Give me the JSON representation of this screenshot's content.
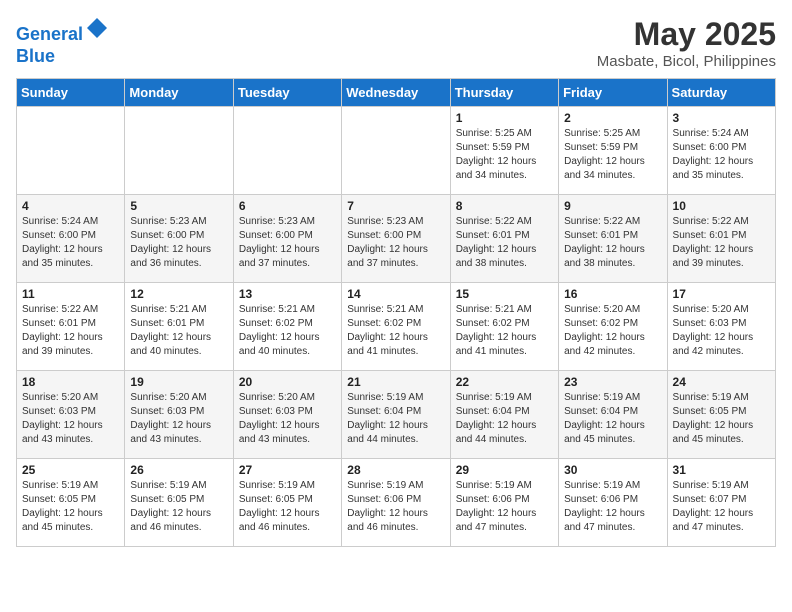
{
  "header": {
    "logo_line1": "General",
    "logo_line2": "Blue",
    "month_year": "May 2025",
    "location": "Masbate, Bicol, Philippines"
  },
  "days_of_week": [
    "Sunday",
    "Monday",
    "Tuesday",
    "Wednesday",
    "Thursday",
    "Friday",
    "Saturday"
  ],
  "weeks": [
    [
      {
        "num": "",
        "detail": ""
      },
      {
        "num": "",
        "detail": ""
      },
      {
        "num": "",
        "detail": ""
      },
      {
        "num": "",
        "detail": ""
      },
      {
        "num": "1",
        "detail": "Sunrise: 5:25 AM\nSunset: 5:59 PM\nDaylight: 12 hours\nand 34 minutes."
      },
      {
        "num": "2",
        "detail": "Sunrise: 5:25 AM\nSunset: 5:59 PM\nDaylight: 12 hours\nand 34 minutes."
      },
      {
        "num": "3",
        "detail": "Sunrise: 5:24 AM\nSunset: 6:00 PM\nDaylight: 12 hours\nand 35 minutes."
      }
    ],
    [
      {
        "num": "4",
        "detail": "Sunrise: 5:24 AM\nSunset: 6:00 PM\nDaylight: 12 hours\nand 35 minutes."
      },
      {
        "num": "5",
        "detail": "Sunrise: 5:23 AM\nSunset: 6:00 PM\nDaylight: 12 hours\nand 36 minutes."
      },
      {
        "num": "6",
        "detail": "Sunrise: 5:23 AM\nSunset: 6:00 PM\nDaylight: 12 hours\nand 37 minutes."
      },
      {
        "num": "7",
        "detail": "Sunrise: 5:23 AM\nSunset: 6:00 PM\nDaylight: 12 hours\nand 37 minutes."
      },
      {
        "num": "8",
        "detail": "Sunrise: 5:22 AM\nSunset: 6:01 PM\nDaylight: 12 hours\nand 38 minutes."
      },
      {
        "num": "9",
        "detail": "Sunrise: 5:22 AM\nSunset: 6:01 PM\nDaylight: 12 hours\nand 38 minutes."
      },
      {
        "num": "10",
        "detail": "Sunrise: 5:22 AM\nSunset: 6:01 PM\nDaylight: 12 hours\nand 39 minutes."
      }
    ],
    [
      {
        "num": "11",
        "detail": "Sunrise: 5:22 AM\nSunset: 6:01 PM\nDaylight: 12 hours\nand 39 minutes."
      },
      {
        "num": "12",
        "detail": "Sunrise: 5:21 AM\nSunset: 6:01 PM\nDaylight: 12 hours\nand 40 minutes."
      },
      {
        "num": "13",
        "detail": "Sunrise: 5:21 AM\nSunset: 6:02 PM\nDaylight: 12 hours\nand 40 minutes."
      },
      {
        "num": "14",
        "detail": "Sunrise: 5:21 AM\nSunset: 6:02 PM\nDaylight: 12 hours\nand 41 minutes."
      },
      {
        "num": "15",
        "detail": "Sunrise: 5:21 AM\nSunset: 6:02 PM\nDaylight: 12 hours\nand 41 minutes."
      },
      {
        "num": "16",
        "detail": "Sunrise: 5:20 AM\nSunset: 6:02 PM\nDaylight: 12 hours\nand 42 minutes."
      },
      {
        "num": "17",
        "detail": "Sunrise: 5:20 AM\nSunset: 6:03 PM\nDaylight: 12 hours\nand 42 minutes."
      }
    ],
    [
      {
        "num": "18",
        "detail": "Sunrise: 5:20 AM\nSunset: 6:03 PM\nDaylight: 12 hours\nand 43 minutes."
      },
      {
        "num": "19",
        "detail": "Sunrise: 5:20 AM\nSunset: 6:03 PM\nDaylight: 12 hours\nand 43 minutes."
      },
      {
        "num": "20",
        "detail": "Sunrise: 5:20 AM\nSunset: 6:03 PM\nDaylight: 12 hours\nand 43 minutes."
      },
      {
        "num": "21",
        "detail": "Sunrise: 5:19 AM\nSunset: 6:04 PM\nDaylight: 12 hours\nand 44 minutes."
      },
      {
        "num": "22",
        "detail": "Sunrise: 5:19 AM\nSunset: 6:04 PM\nDaylight: 12 hours\nand 44 minutes."
      },
      {
        "num": "23",
        "detail": "Sunrise: 5:19 AM\nSunset: 6:04 PM\nDaylight: 12 hours\nand 45 minutes."
      },
      {
        "num": "24",
        "detail": "Sunrise: 5:19 AM\nSunset: 6:05 PM\nDaylight: 12 hours\nand 45 minutes."
      }
    ],
    [
      {
        "num": "25",
        "detail": "Sunrise: 5:19 AM\nSunset: 6:05 PM\nDaylight: 12 hours\nand 45 minutes."
      },
      {
        "num": "26",
        "detail": "Sunrise: 5:19 AM\nSunset: 6:05 PM\nDaylight: 12 hours\nand 46 minutes."
      },
      {
        "num": "27",
        "detail": "Sunrise: 5:19 AM\nSunset: 6:05 PM\nDaylight: 12 hours\nand 46 minutes."
      },
      {
        "num": "28",
        "detail": "Sunrise: 5:19 AM\nSunset: 6:06 PM\nDaylight: 12 hours\nand 46 minutes."
      },
      {
        "num": "29",
        "detail": "Sunrise: 5:19 AM\nSunset: 6:06 PM\nDaylight: 12 hours\nand 47 minutes."
      },
      {
        "num": "30",
        "detail": "Sunrise: 5:19 AM\nSunset: 6:06 PM\nDaylight: 12 hours\nand 47 minutes."
      },
      {
        "num": "31",
        "detail": "Sunrise: 5:19 AM\nSunset: 6:07 PM\nDaylight: 12 hours\nand 47 minutes."
      }
    ]
  ]
}
